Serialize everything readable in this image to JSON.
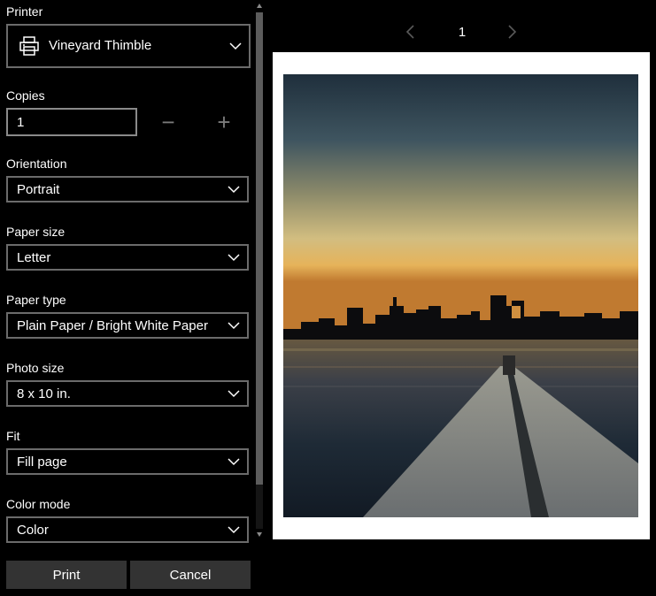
{
  "settings": {
    "printer": {
      "label": "Printer",
      "value": "Vineyard Thimble"
    },
    "copies": {
      "label": "Copies",
      "value": "1",
      "decrement": "−",
      "increment": "+"
    },
    "orientation": {
      "label": "Orientation",
      "value": "Portrait"
    },
    "paper_size": {
      "label": "Paper size",
      "value": "Letter"
    },
    "paper_type": {
      "label": "Paper type",
      "value": "Plain Paper / Bright White Paper"
    },
    "photo_size": {
      "label": "Photo size",
      "value": "8 x 10 in."
    },
    "fit": {
      "label": "Fit",
      "value": "Fill page"
    },
    "color_mode": {
      "label": "Color mode",
      "value": "Color"
    }
  },
  "actions": {
    "print": "Print",
    "cancel": "Cancel"
  },
  "preview": {
    "page_number": "1",
    "prev_icon": "chevron-left-icon",
    "next_icon": "chevron-right-icon"
  },
  "colors": {
    "background": "#000000",
    "field_border": "#6b6b6b",
    "button_bg": "#333333",
    "text": "#ffffff",
    "disabled": "#7a7a7a"
  }
}
